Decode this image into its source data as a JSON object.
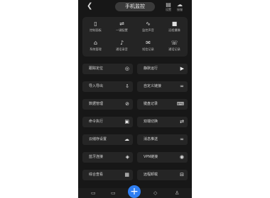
{
  "header": {
    "back_icon": "back-arrow-icon",
    "title": "手机监控",
    "settings_label": "设置",
    "cloud_label": "接服"
  },
  "quick_actions": [
    {
      "label": "控制面板",
      "icon": "phone-icon",
      "glyph": "▯"
    },
    {
      "label": "一键配置",
      "icon": "sliders-icon",
      "glyph": "⇌"
    },
    {
      "label": "监控声音",
      "icon": "waveform-icon",
      "glyph": "∿"
    },
    {
      "label": "远程摄像",
      "icon": "video-camera-icon",
      "glyph": "■"
    },
    {
      "label": "系统管理",
      "icon": "network-icon",
      "glyph": "⌂"
    },
    {
      "label": "通话录音",
      "icon": "microphone-icon",
      "glyph": "♪"
    },
    {
      "label": "短信记录",
      "icon": "mail-icon",
      "glyph": "✉"
    },
    {
      "label": "通话记录",
      "icon": "phone-call-icon",
      "glyph": "☏"
    }
  ],
  "function_cards": [
    {
      "label": "跟踪定位",
      "icon": "location-icon",
      "glyph": "◎"
    },
    {
      "label": "静默运行",
      "icon": "play-icon",
      "glyph": "▶"
    },
    {
      "label": "导入导出",
      "icon": "import-export-icon",
      "glyph": "⇩"
    },
    {
      "label": "自定义链接",
      "icon": "link-icon",
      "glyph": "∞"
    },
    {
      "label": "数据管理",
      "icon": "data-icon",
      "glyph": "⊘"
    },
    {
      "label": "键盘记录",
      "icon": "keyboard-icon",
      "glyph": "⌨"
    },
    {
      "label": "命令执行",
      "icon": "terminal-icon",
      "glyph": "▣"
    },
    {
      "label": "双端切换",
      "icon": "switch-icon",
      "glyph": "⇄"
    },
    {
      "label": "云储存设置",
      "icon": "cloud-storage-icon",
      "glyph": "☁"
    },
    {
      "label": "消息推送",
      "icon": "message-link-icon",
      "glyph": "∞"
    },
    {
      "label": "蓝牙连接",
      "icon": "bluetooth-icon",
      "glyph": "◈"
    },
    {
      "label": "VPN链接",
      "icon": "vpn-icon",
      "glyph": "◉"
    },
    {
      "label": "综合查看",
      "icon": "grid-icon",
      "glyph": "▦"
    },
    {
      "label": "远程卸载",
      "icon": "uninstall-icon",
      "glyph": "⊟"
    }
  ],
  "bottom_nav": [
    {
      "icon": "chat-icon",
      "glyph": "▭"
    },
    {
      "icon": "monitor-icon",
      "glyph": "▭"
    },
    {
      "icon": "add-icon",
      "glyph": "+"
    },
    {
      "icon": "diamond-icon",
      "glyph": "◇"
    },
    {
      "icon": "profile-icon",
      "glyph": "♙"
    }
  ],
  "colors": {
    "background": "#171717",
    "card": "#252525",
    "accent": "#2f7ff3"
  }
}
